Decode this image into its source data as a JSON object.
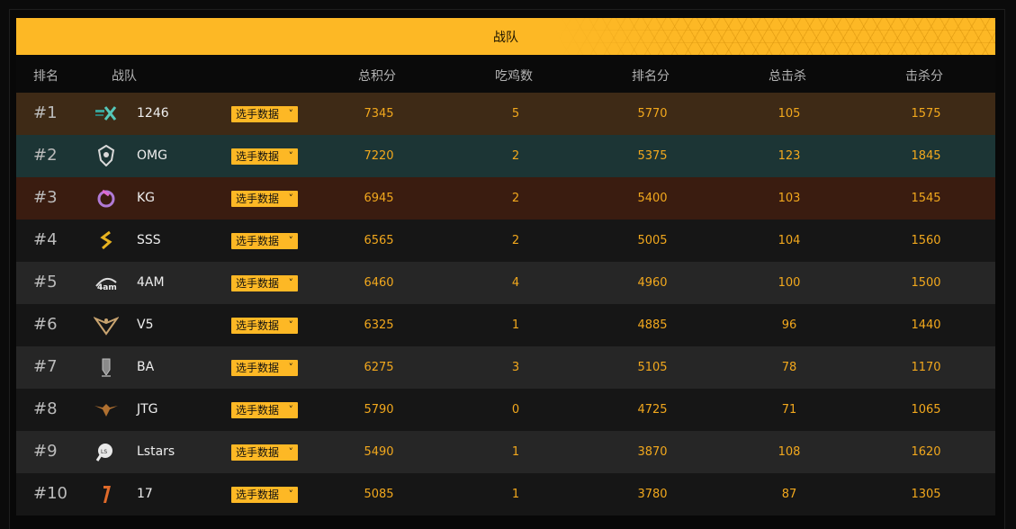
{
  "banner": {
    "title": "战队"
  },
  "header": {
    "rank": "排名",
    "team": "战队",
    "total": "总积分",
    "chicken": "吃鸡数",
    "rank_points": "排名分",
    "total_kills": "总击杀",
    "kill_points": "击杀分"
  },
  "button_label": "选手数据",
  "colors": {
    "accent": "#fdb825",
    "value_text": "#f2a81d"
  },
  "rows": [
    {
      "rank": "#1",
      "team": "1246",
      "logo": "1246-logo-icon",
      "total": "7345",
      "chicken": "5",
      "rank_points": "5770",
      "kills": "105",
      "kill_points": "1575",
      "bg": "#3e2a16"
    },
    {
      "rank": "#2",
      "team": "OMG",
      "logo": "omg-logo-icon",
      "total": "7220",
      "chicken": "2",
      "rank_points": "5375",
      "kills": "123",
      "kill_points": "1845",
      "bg": "#1c3535"
    },
    {
      "rank": "#3",
      "team": "KG",
      "logo": "kg-logo-icon",
      "total": "6945",
      "chicken": "2",
      "rank_points": "5400",
      "kills": "103",
      "kill_points": "1545",
      "bg": "#3a1c10"
    },
    {
      "rank": "#4",
      "team": "SSS",
      "logo": "sss-logo-icon",
      "total": "6565",
      "chicken": "2",
      "rank_points": "5005",
      "kills": "104",
      "kill_points": "1560",
      "bg": "#161616"
    },
    {
      "rank": "#5",
      "team": "4AM",
      "logo": "4am-logo-icon",
      "total": "6460",
      "chicken": "4",
      "rank_points": "4960",
      "kills": "100",
      "kill_points": "1500",
      "bg": "#262626"
    },
    {
      "rank": "#6",
      "team": "V5",
      "logo": "v5-logo-icon",
      "total": "6325",
      "chicken": "1",
      "rank_points": "4885",
      "kills": "96",
      "kill_points": "1440",
      "bg": "#161616"
    },
    {
      "rank": "#7",
      "team": "BA",
      "logo": "ba-logo-icon",
      "total": "6275",
      "chicken": "3",
      "rank_points": "5105",
      "kills": "78",
      "kill_points": "1170",
      "bg": "#262626"
    },
    {
      "rank": "#8",
      "team": "JTG",
      "logo": "jtg-logo-icon",
      "total": "5790",
      "chicken": "0",
      "rank_points": "4725",
      "kills": "71",
      "kill_points": "1065",
      "bg": "#161616"
    },
    {
      "rank": "#9",
      "team": "Lstars",
      "logo": "lstars-logo-icon",
      "total": "5490",
      "chicken": "1",
      "rank_points": "3870",
      "kills": "108",
      "kill_points": "1620",
      "bg": "#262626"
    },
    {
      "rank": "#10",
      "team": "17",
      "logo": "17-logo-icon",
      "total": "5085",
      "chicken": "1",
      "rank_points": "3780",
      "kills": "87",
      "kill_points": "1305",
      "bg": "#161616"
    }
  ]
}
